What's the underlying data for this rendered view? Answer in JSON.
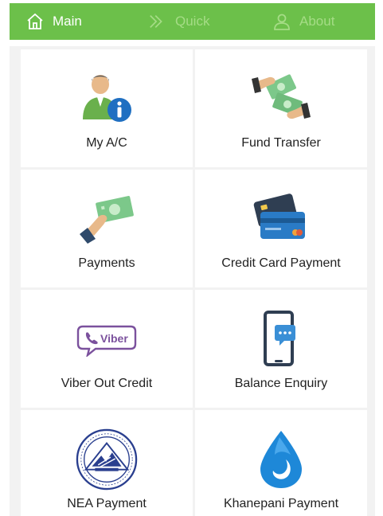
{
  "tabs": {
    "main": "Main",
    "quick": "Quick",
    "about": "About"
  },
  "tiles": [
    {
      "label": "My A/C",
      "icon": "user-info-icon"
    },
    {
      "label": "Fund Transfer",
      "icon": "money-hand-transfer-icon"
    },
    {
      "label": "Payments",
      "icon": "cash-payment-icon"
    },
    {
      "label": "Credit Card Payment",
      "icon": "credit-card-icon"
    },
    {
      "label": "Viber Out Credit",
      "icon": "viber-logo-icon"
    },
    {
      "label": "Balance Enquiry",
      "icon": "phone-message-icon"
    },
    {
      "label": "NEA Payment",
      "icon": "nea-seal-icon"
    },
    {
      "label": "Khanepani Payment",
      "icon": "water-drop-icon"
    }
  ],
  "viber_logo_text": "Viber",
  "colors": {
    "tabbar": "#6cc04a",
    "tab_active": "#ffffff",
    "tab_inactive": "#a5dc86",
    "grid_bg": "#f2f2f2",
    "tile_bg": "#ffffff",
    "viber": "#7b519d",
    "info_blue": "#1f6fc1",
    "water_blue": "#1e88d8",
    "money_green": "#7cc88a"
  }
}
